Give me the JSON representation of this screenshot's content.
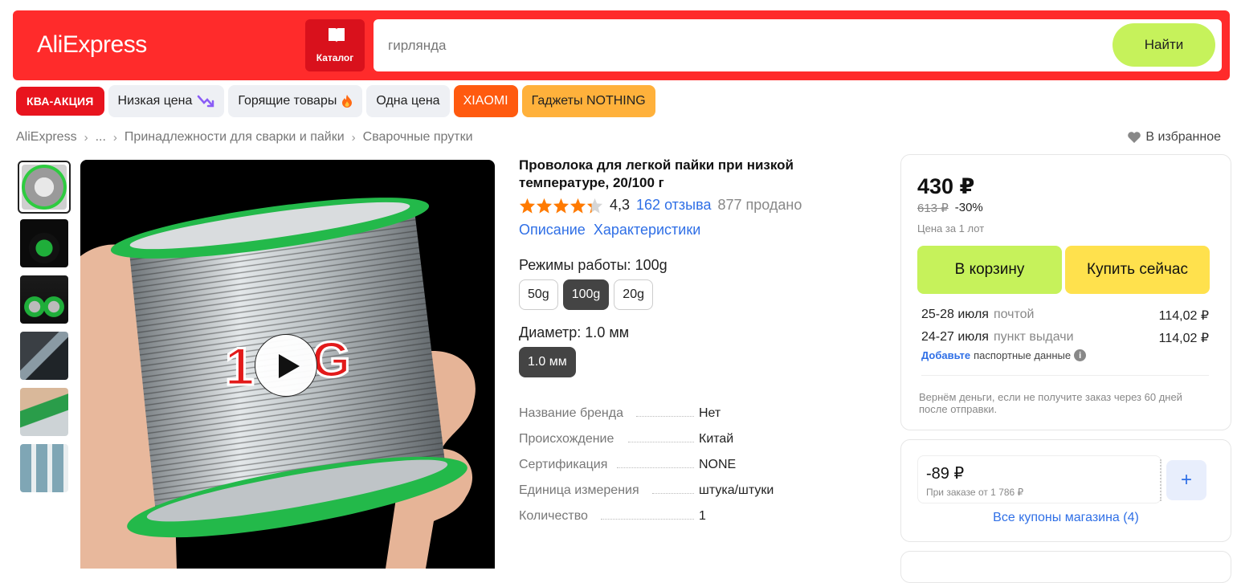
{
  "header": {
    "logo": "AliExpress",
    "catalog_label": "Каталог",
    "search_placeholder": "гирлянда",
    "search_button": "Найти"
  },
  "chips": [
    {
      "label": "КВА-АКЦИЯ",
      "style": "kva"
    },
    {
      "label": "Низкая цена",
      "icon": "price-down-arrow-icon"
    },
    {
      "label": "Горящие товары",
      "icon": "fire-icon"
    },
    {
      "label": "Одна цена"
    },
    {
      "label": "XIAOMI",
      "style": "xiaomi"
    },
    {
      "label": "Гаджеты NOTHING",
      "style": "nothing"
    }
  ],
  "breadcrumb": [
    "AliExpress",
    "...",
    "Принадлежности для сварки и пайки",
    "Сварочные прутки"
  ],
  "favorite_label": "В избранное",
  "product": {
    "title": "Проволока для легкой пайки при низкой температуре, 20/100 г",
    "rating": "4,3",
    "rating_stars": 4.3,
    "reviews": "162 отзыва",
    "sold": "877 продано",
    "links": [
      "Описание",
      "Характеристики"
    ],
    "mode_label": "Режимы работы: 100g",
    "modes": [
      "50g",
      "100g",
      "20g"
    ],
    "mode_selected": "100g",
    "diameter_label": "Диаметр: 1.0 мм",
    "diameters": [
      "1.0 мм"
    ],
    "specs": [
      {
        "key": "Название бренда",
        "value": "Нет"
      },
      {
        "key": "Происхождение",
        "value": "Китай"
      },
      {
        "key": "Сертификация",
        "value": "NONE"
      },
      {
        "key": "Единица измерения",
        "value": "штука/штуки"
      },
      {
        "key": "Количество",
        "value": "1"
      }
    ]
  },
  "price_card": {
    "price": "430 ₽",
    "old_price": "613 ₽",
    "discount": "-30%",
    "per_lot": "Цена за 1 лот",
    "cart_button": "В корзину",
    "buy_button": "Купить сейчас",
    "delivery": [
      {
        "date": "25-28 июля",
        "method": "почтой",
        "price": "114,02 ₽"
      },
      {
        "date": "24-27 июля",
        "method": "пункт выдачи",
        "price": "114,02 ₽"
      }
    ],
    "passport_link": "Добавьте",
    "passport_text": "паспортные данные",
    "refund": "Вернём деньги, если не получите заказ через 60 дней после отправки."
  },
  "coupon_card": {
    "amount": "-89 ₽",
    "min_order": "При заказе от 1 786 ₽",
    "all_coupons": "Все купоны магазина (4)"
  },
  "colors": {
    "brand_red": "#ff2b2b",
    "cart_green": "#c6f25b",
    "buy_yellow": "#ffe14d",
    "link_blue": "#2f6fe6",
    "star_orange": "#ff7a00"
  }
}
